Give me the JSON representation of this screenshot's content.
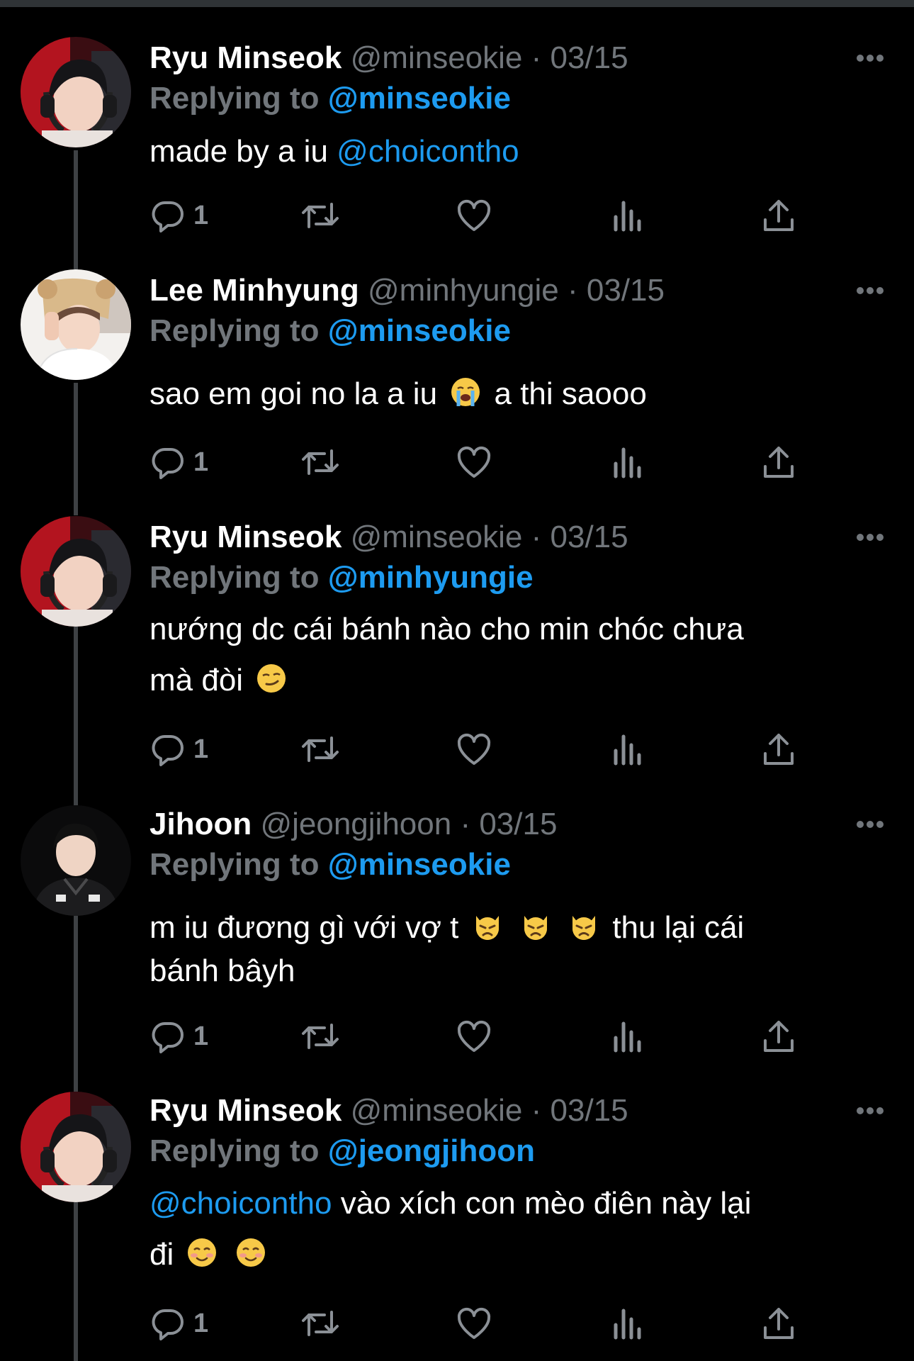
{
  "tweets": [
    {
      "author_name": "Ryu Minseok",
      "handle": "@minseokie",
      "date": "03/15",
      "replying_label": "Replying to",
      "replying_to": "@minseokie",
      "text_before": "made by a iu ",
      "text_mention": "@choicontho",
      "reply_count": "1"
    },
    {
      "author_name": "Lee Minhyung",
      "handle": "@minhyungie",
      "date": "03/15",
      "replying_label": "Replying to",
      "replying_to": "@minseokie",
      "text_part1": "sao em goi no la a iu",
      "text_part2": "a thi saooo",
      "emoji": "loudly-crying-face",
      "reply_count": "1"
    },
    {
      "author_name": "Ryu Minseok",
      "handle": "@minseokie",
      "date": "03/15",
      "replying_label": "Replying to",
      "replying_to": "@minhyungie",
      "text_line1": "nướng dc cái bánh nào cho min chóc chưa",
      "text_line2": "mà đòi",
      "emoji": "smirking-face",
      "reply_count": "1"
    },
    {
      "author_name": "Jihoon",
      "handle": "@jeongjihoon",
      "date": "03/15",
      "replying_label": "Replying to",
      "replying_to": "@minseokie",
      "text_line1_part1": "m iu đương gì với vợ t",
      "text_line1_part2": "thu lại cái",
      "text_line2": "bánh bâyh",
      "emoji": "pouting-cat",
      "reply_count": "1"
    },
    {
      "author_name": "Ryu Minseok",
      "handle": "@minseokie",
      "date": "03/15",
      "replying_label": "Replying to",
      "replying_to": "@jeongjihoon",
      "text_mention": "@choicontho",
      "text_line1_rest": " vào xích con mèo điên này lại",
      "text_line2": "đi",
      "emoji": "smiling-face",
      "reply_count": "1"
    }
  ],
  "header_separator": "·",
  "icons": [
    "reply-icon",
    "retweet-icon",
    "like-icon",
    "views-icon",
    "share-icon",
    "more-icon"
  ],
  "colors": {
    "background": "#000000",
    "text": "#ffffff",
    "muted": "#71767b",
    "link": "#1d9bf0",
    "thread_line": "#3e4144"
  }
}
